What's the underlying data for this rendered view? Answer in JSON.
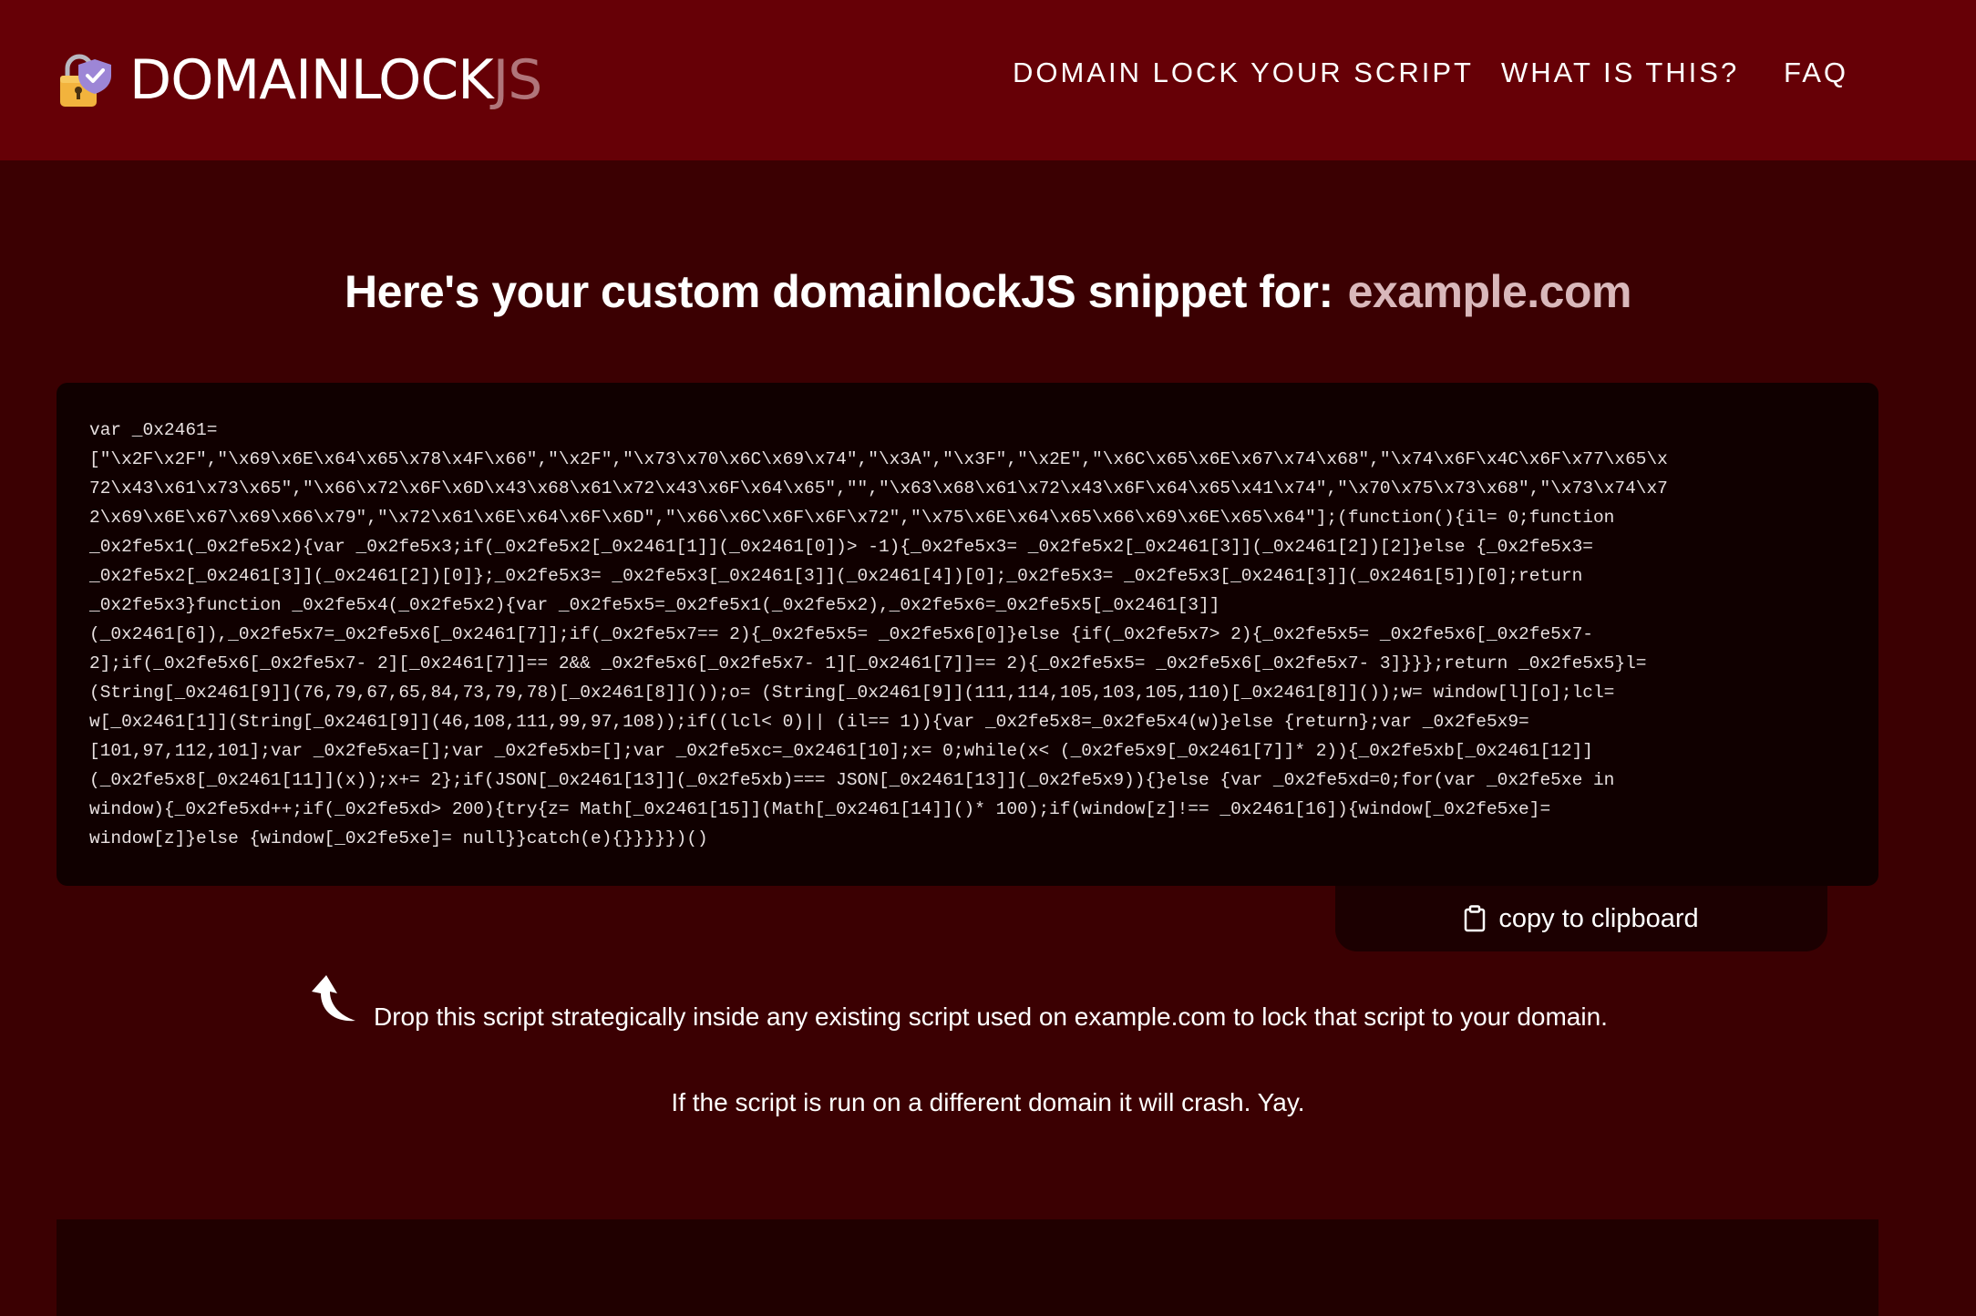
{
  "header": {
    "logo": {
      "main": "DOMAINLOCK",
      "suffix": "JS",
      "icon": "lock-shield-icon"
    },
    "nav": [
      {
        "label": "DOMAIN LOCK YOUR SCRIPT"
      },
      {
        "label": "WHAT IS THIS?"
      },
      {
        "label": "FAQ"
      }
    ]
  },
  "main": {
    "heading": "Here's your custom domainlockJS snippet for:",
    "domain": "example.com",
    "code_lines": [
      "var _0x2461=",
      "[\"\\x2F\\x2F\",\"\\x69\\x6E\\x64\\x65\\x78\\x4F\\x66\",\"\\x2F\",\"\\x73\\x70\\x6C\\x69\\x74\",\"\\x3A\",\"\\x3F\",\"\\x2E\",\"\\x6C\\x65\\x6E\\x67\\x74\\x68\",\"\\x74\\x6F\\x4C\\x6F\\x77\\x65\\x",
      "72\\x43\\x61\\x73\\x65\",\"\\x66\\x72\\x6F\\x6D\\x43\\x68\\x61\\x72\\x43\\x6F\\x64\\x65\",\"\",\"\\x63\\x68\\x61\\x72\\x43\\x6F\\x64\\x65\\x41\\x74\",\"\\x70\\x75\\x73\\x68\",\"\\x73\\x74\\x7",
      "2\\x69\\x6E\\x67\\x69\\x66\\x79\",\"\\x72\\x61\\x6E\\x64\\x6F\\x6D\",\"\\x66\\x6C\\x6F\\x6F\\x72\",\"\\x75\\x6E\\x64\\x65\\x66\\x69\\x6E\\x65\\x64\"];(function(){il= 0;function",
      "_0x2fe5x1(_0x2fe5x2){var _0x2fe5x3;if(_0x2fe5x2[_0x2461[1]](_0x2461[0])> -1){_0x2fe5x3= _0x2fe5x2[_0x2461[3]](_0x2461[2])[2]}else {_0x2fe5x3=",
      "_0x2fe5x2[_0x2461[3]](_0x2461[2])[0]};_0x2fe5x3= _0x2fe5x3[_0x2461[3]](_0x2461[4])[0];_0x2fe5x3= _0x2fe5x3[_0x2461[3]](_0x2461[5])[0];return",
      "_0x2fe5x3}function _0x2fe5x4(_0x2fe5x2){var _0x2fe5x5=_0x2fe5x1(_0x2fe5x2),_0x2fe5x6=_0x2fe5x5[_0x2461[3]]",
      "(_0x2461[6]),_0x2fe5x7=_0x2fe5x6[_0x2461[7]];if(_0x2fe5x7== 2){_0x2fe5x5= _0x2fe5x6[0]}else {if(_0x2fe5x7> 2){_0x2fe5x5= _0x2fe5x6[_0x2fe5x7-",
      "2];if(_0x2fe5x6[_0x2fe5x7- 2][_0x2461[7]]== 2&& _0x2fe5x6[_0x2fe5x7- 1][_0x2461[7]]== 2){_0x2fe5x5= _0x2fe5x6[_0x2fe5x7- 3]}}};return _0x2fe5x5}l=",
      "(String[_0x2461[9]](76,79,67,65,84,73,79,78)[_0x2461[8]]());o= (String[_0x2461[9]](111,114,105,103,105,110)[_0x2461[8]]());w= window[l][o];lcl=",
      "w[_0x2461[1]](String[_0x2461[9]](46,108,111,99,97,108));if((lcl< 0)|| (il== 1)){var _0x2fe5x8=_0x2fe5x4(w)}else {return};var _0x2fe5x9=",
      "[101,97,112,101];var _0x2fe5xa=[];var _0x2fe5xb=[];var _0x2fe5xc=_0x2461[10];x= 0;while(x< (_0x2fe5x9[_0x2461[7]]* 2)){_0x2fe5xb[_0x2461[12]]",
      "(_0x2fe5x8[_0x2461[11]](x));x+= 2};if(JSON[_0x2461[13]](_0x2fe5xb)=== JSON[_0x2461[13]](_0x2fe5x9)){}else {var _0x2fe5xd=0;for(var _0x2fe5xe in",
      "window){_0x2fe5xd++;if(_0x2fe5xd> 200){try{z= Math[_0x2461[15]](Math[_0x2461[14]]()* 100);if(window[z]!== _0x2461[16]){window[_0x2fe5xe]=",
      "window[z]}else {window[_0x2fe5xe]= null}}catch(e){}}}}})()"
    ],
    "copy_label": "copy to clipboard",
    "copy_icon": "clipboard-icon",
    "drop_icon": "curved-arrow-up-icon",
    "drop_text": "Drop this script strategically inside any existing script used on example.com to lock that script to your domain.",
    "crash_text": "If the script is run on a different domain it will crash. Yay."
  }
}
